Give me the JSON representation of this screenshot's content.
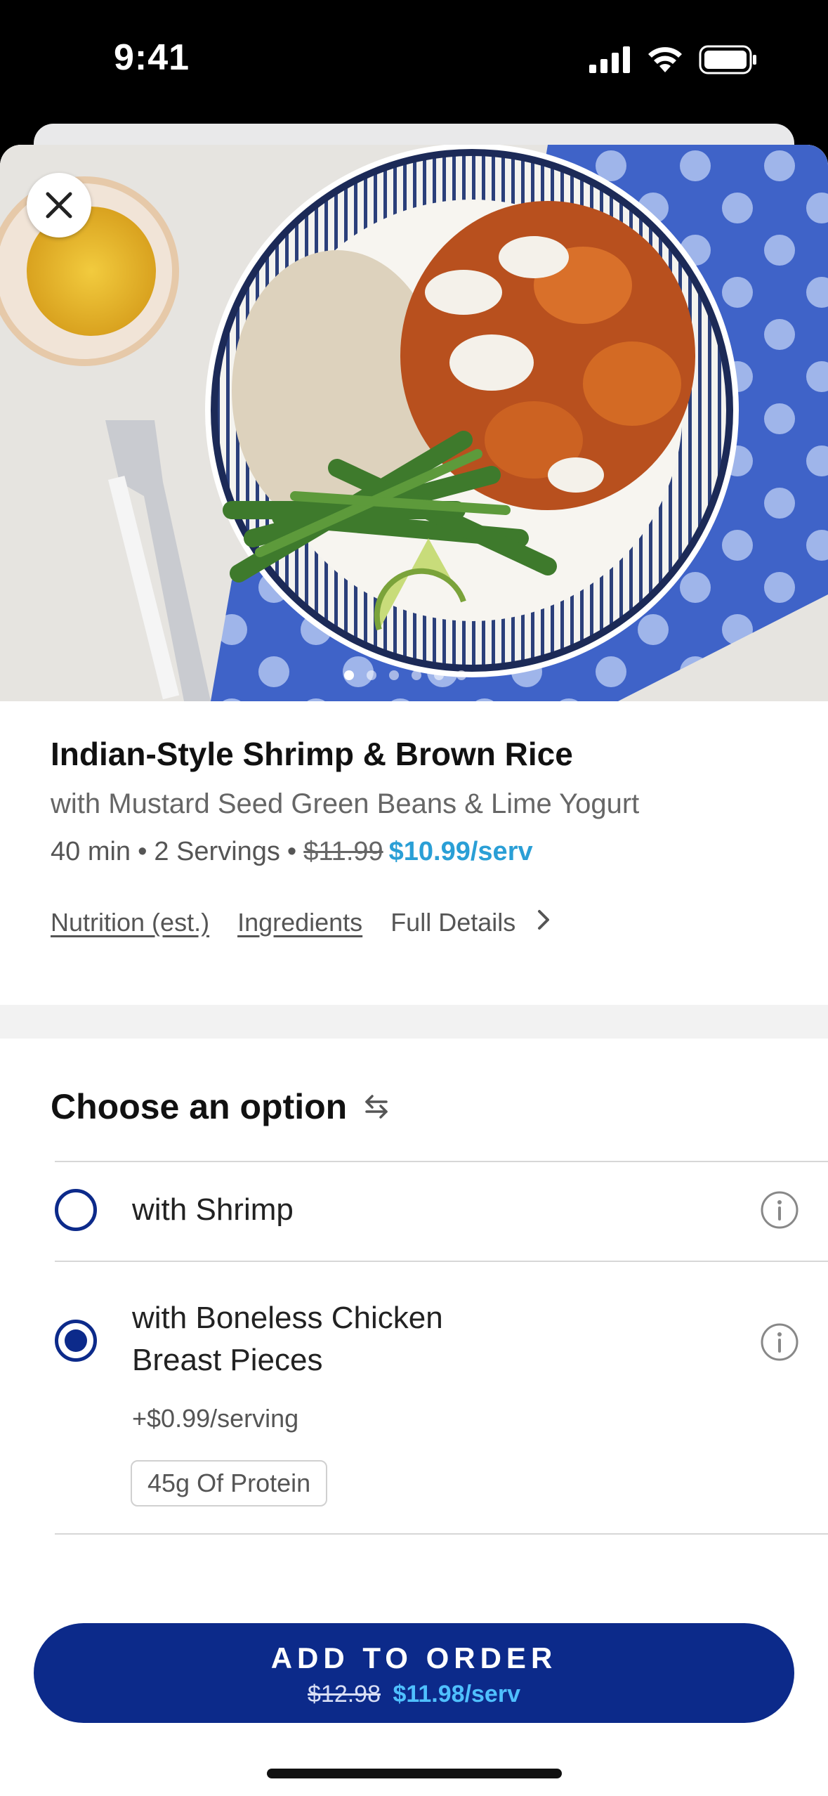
{
  "status_bar": {
    "time": "9:41"
  },
  "hero": {
    "image_icon": "meal-photo",
    "photo_count": 6,
    "active_photo": 1
  },
  "meal": {
    "title": "Indian-Style Shrimp & Brown Rice",
    "subtitle": "with Mustard Seed Green Beans & Lime Yogurt",
    "time": "40 min",
    "servings": "2 Servings",
    "old_price": "$11.99",
    "new_price": "$10.99/serv"
  },
  "links": {
    "nutrition": "Nutrition (est.)",
    "ingredients": "Ingredients",
    "full_details": "Full Details"
  },
  "options": {
    "heading": "Choose an option",
    "items": [
      {
        "label": "with Shrimp",
        "selected": false
      },
      {
        "label_line1": "with Boneless Chicken",
        "label_line2": "Breast Pieces",
        "price": "+$0.99/serving",
        "badge": "45g Of Protein",
        "selected": true
      }
    ]
  },
  "cta": {
    "label": "ADD TO ORDER",
    "old_price": "$12.98",
    "new_price": "$11.98/serv"
  },
  "colors": {
    "brand_navy": "#0c2a8a",
    "accent_blue": "#2a9fd6"
  }
}
